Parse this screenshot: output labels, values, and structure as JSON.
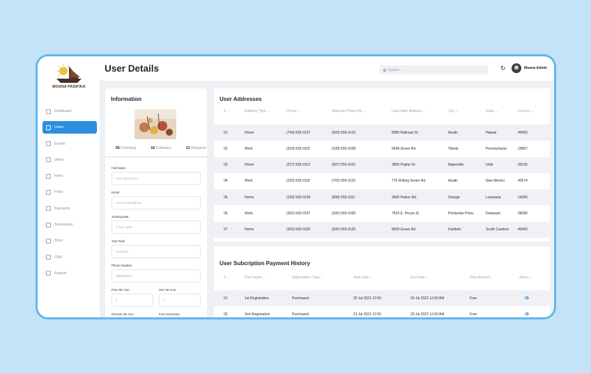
{
  "app": {
    "logo_text": "MOANA PASIFIKA",
    "page_title": "User Details",
    "search_placeholder": "Search...",
    "admin_name": "Moana-Admin"
  },
  "sidebar": {
    "items": [
      {
        "label": "Dashboard",
        "icon": "grid-icon",
        "active": false
      },
      {
        "label": "Users",
        "icon": "users-icon",
        "active": true
      },
      {
        "label": "Events",
        "icon": "calendar-icon",
        "active": false
      },
      {
        "label": "Offers",
        "icon": "offer-icon",
        "active": false
      },
      {
        "label": "News",
        "icon": "news-icon",
        "active": false
      },
      {
        "label": "Plans",
        "icon": "plans-icon",
        "active": false
      },
      {
        "label": "Payments",
        "icon": "payments-icon",
        "active": false
      },
      {
        "label": "Sanctuaries",
        "icon": "sanctuary-icon",
        "active": false
      },
      {
        "label": "Store",
        "icon": "cart-icon",
        "active": false
      },
      {
        "label": "CMS",
        "icon": "cms-icon",
        "active": false
      },
      {
        "label": "Reports",
        "icon": "reports-icon",
        "active": false
      }
    ]
  },
  "info": {
    "title": "Information",
    "following_count": "65",
    "following_label": "Following",
    "followers_count": "18",
    "followers_label": "Followers",
    "requests_count": "21",
    "requests_label": "Requests",
    "fields": [
      {
        "label": "Full Name",
        "value": "Your name here"
      },
      {
        "label": "Email",
        "value": "Your email address"
      },
      {
        "label": "Joining Date",
        "value": "1 Feb, 2020"
      },
      {
        "label": "Your Role",
        "value": "Guardian"
      },
      {
        "label": "Phone Number",
        "value": "2580963147"
      }
    ],
    "half_fields": [
      {
        "label": "Free SE Icon",
        "value": "4"
      },
      {
        "label": "Use SE Icon",
        "value": "4"
      },
      {
        "label": "Remain SE Icon",
        "value": ""
      },
      {
        "label": "Free Sanctuary",
        "value": ""
      }
    ]
  },
  "addresses": {
    "title": "User Addresses",
    "columns": [
      "#",
      "Address Type",
      "Phone",
      "Alternate Phone No",
      "Land Mark Address",
      "City",
      "State",
      "Country"
    ],
    "rows": [
      [
        "01",
        "Home",
        "(704) 555-0127",
        "(603) 555-0123",
        "8080 Railroad St.",
        "Austin",
        "Hawaii",
        "45453"
      ],
      [
        "02",
        "Work",
        "(319) 555-0115",
        "(239) 555-0108",
        "6548 Green Rd.",
        "Toledo",
        "Pennsylvania",
        "19897"
      ],
      [
        "03",
        "Home",
        "(217) 555-0113",
        "(907) 555-0101",
        "3890 Poplar Dr.",
        "Naperville",
        "Utah",
        "93126"
      ],
      [
        "04",
        "Work",
        "(225) 555-0118",
        "(702) 555-0122",
        "775 Rolling Green Rd.",
        "Austin",
        "New Mexico",
        "42574"
      ],
      [
        "05",
        "Home",
        "(229) 555-0109",
        "(808) 555-0111",
        "3605 Parker Rd.",
        "Orange",
        "Louisiana",
        "14355"
      ],
      [
        "06",
        "Work",
        "(302) 555-0107",
        "(205) 555-0100",
        "7529 E. Pecan St.",
        "Pembroke Pines",
        "Delaware",
        "98380"
      ],
      [
        "07",
        "Home",
        "(303) 555-0105",
        "(505) 555-0125",
        "8558 Green Rd.",
        "Fairfield",
        "South Carolina",
        "45463"
      ]
    ]
  },
  "payments": {
    "title": "User Subcription Payment History",
    "columns": [
      "#",
      "Plan Name",
      "Subscription Type",
      "Start Date",
      "End Date",
      "Total Amount",
      "Action"
    ],
    "rows": [
      [
        "01",
        "1st Registration",
        "Purchased",
        "20 Jul 2021 12:00",
        "20 Jul 2022 12:00 AM",
        "Free"
      ],
      [
        "02",
        "2nd Registration",
        "Purchased",
        "21 Jul 2021 12:00",
        "20 Jul 2022 12:00 AM",
        "Free"
      ]
    ]
  },
  "colors": {
    "accent": "#2d8fdd",
    "background": "#c5e3f7",
    "frame_border": "#62b6ec"
  }
}
